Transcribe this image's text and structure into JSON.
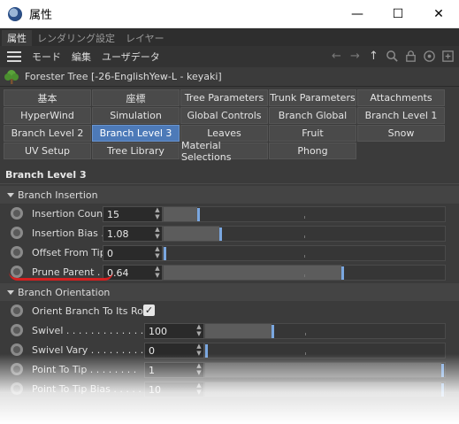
{
  "window": {
    "title": "属性",
    "minimize_glyph": "—",
    "maximize_glyph": "☐",
    "close_glyph": "✕"
  },
  "panel_tabs": [
    {
      "label": "属性",
      "active": true
    },
    {
      "label": "レンダリング設定",
      "active": false
    },
    {
      "label": "レイヤー",
      "active": false
    }
  ],
  "menu": {
    "items": [
      "モード",
      "編集",
      "ユーザデータ"
    ],
    "tool_icons": [
      "arrow-left-icon",
      "arrow-right-icon",
      "arrow-up-icon",
      "search-icon",
      "lock-icon",
      "target-icon",
      "add-icon"
    ]
  },
  "object": {
    "name": "Forester Tree [-26-EnglishYew-L - keyaki]",
    "icon": "tree-icon"
  },
  "tab_grid": [
    [
      "基本",
      "座標",
      "Tree Parameters",
      "Trunk Parameters",
      "Attachments"
    ],
    [
      "HyperWind",
      "Simulation",
      "Global Controls",
      "Branch Global",
      "Branch Level 1"
    ],
    [
      "Branch Level 2",
      "Branch Level 3",
      "Leaves",
      "Fruit",
      "Snow"
    ],
    [
      "UV Setup",
      "Tree Library",
      "Material Selections",
      "Phong"
    ]
  ],
  "active_tab": "Branch Level 3",
  "section_title": "Branch Level 3",
  "groups": {
    "insertion": "Branch Insertion",
    "orientation": "Branch Orientation"
  },
  "params": {
    "insertion_count": {
      "label": "Insertion Count",
      "value": "15",
      "level": 0.12
    },
    "insertion_bias": {
      "label": "Insertion Bias .",
      "value": "1.08",
      "level": 0.2
    },
    "offset_from_tip": {
      "label": "Offset From Tip",
      "value": "0",
      "level": 0.0
    },
    "prune_parent": {
      "label": "Prune Parent .",
      "value": "0.64",
      "level": 0.64
    },
    "orient_to_root": {
      "label": "Orient Branch To Its Root",
      "checked": true,
      "check_glyph": "✓"
    },
    "swivel": {
      "label": "Swivel . . . . . . . . . . . . .",
      "value": "100",
      "level": 0.28
    },
    "swivel_vary": {
      "label": "Swivel Vary . . . . . . . . .",
      "value": "0",
      "level": 0.0
    },
    "point_to_tip": {
      "label": "Point To Tip . . . . . . . .",
      "value": "1",
      "level": 1.0
    },
    "point_to_tip_bias": {
      "label": "Point To Tip Bias . . . . .",
      "value": "10",
      "level": 1.0
    }
  },
  "colors": {
    "accent": "#4d7ab8",
    "panel_bg": "#3b3b3b",
    "annotation_red": "#d42020"
  }
}
